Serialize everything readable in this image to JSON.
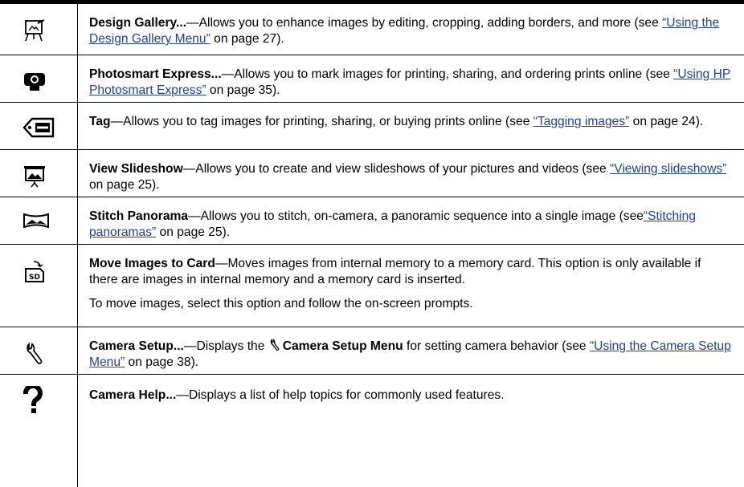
{
  "rows": [
    {
      "icon": "design-gallery-icon",
      "title": "Design Gallery...",
      "desc": "—Allows you to enhance images by editing, cropping, adding borders, and more (see ",
      "link": "“Using the Design Gallery Menu”",
      "tail": " on page 27)."
    },
    {
      "icon": "photosmart-express-icon",
      "title": "Photosmart Express...",
      "desc": "—Allows you to mark images for printing, sharing, and ordering prints online (see ",
      "link": "“Using HP Photosmart Express”",
      "tail": " on page 35)."
    },
    {
      "icon": "tag-icon",
      "title": "Tag",
      "desc": "—Allows you to tag images for printing, sharing, or buying prints online (see ",
      "link": "“Tagging images”",
      "tail": " on page 24)."
    },
    {
      "icon": "slideshow-icon",
      "title": "View Slideshow",
      "desc": "—Allows you to create and view slideshows of your pictures and videos (see ",
      "link": "“Viewing slideshows”",
      "tail": " on page 25)."
    },
    {
      "icon": "panorama-icon",
      "title": "Stitch Panorama",
      "desc": "—Allows you to stitch, on-camera, a panoramic sequence into a single image (see",
      "link": "“Stitching panoramas”",
      "tail": " on page 25)."
    },
    {
      "icon": "move-to-card-icon",
      "title": "Move Images to Card",
      "desc": "—Moves images from internal memory to a memory card. This option is only available if there are images in internal memory and a memory card is inserted.",
      "para2": "To move images, select this option and follow the on-screen prompts."
    },
    {
      "icon": "wrench-icon",
      "title": "Camera Setup...",
      "desc": "—Displays the ",
      "menu": "Camera Setup Menu",
      "desc2": " for setting camera behavior (see ",
      "link": "“Using the Camera Setup Menu”",
      "tail": " on page 38)."
    },
    {
      "icon": "help-icon",
      "title": "Camera Help...",
      "desc": "—Displays a list of help topics for commonly used features."
    }
  ]
}
